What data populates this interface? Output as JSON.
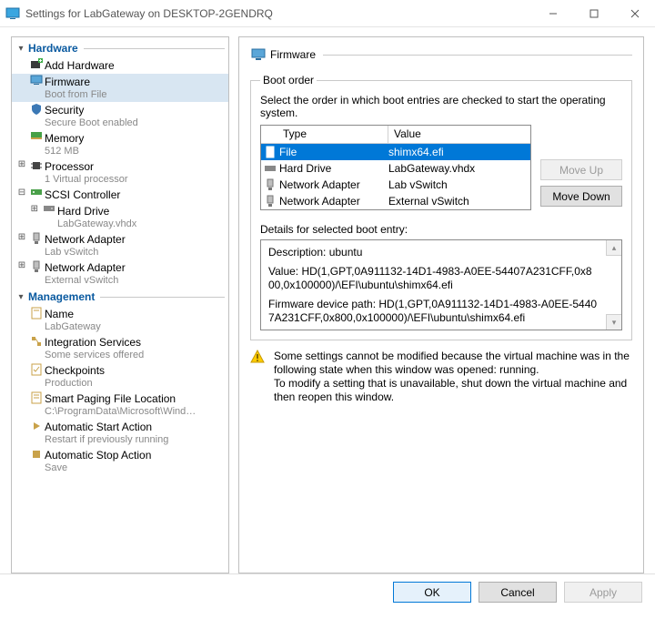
{
  "window": {
    "title": "Settings for LabGateway on DESKTOP-2GENDRQ"
  },
  "nav": {
    "hardware_label": "Hardware",
    "management_label": "Management",
    "add_hardware": "Add Hardware",
    "firmware": {
      "label": "Firmware",
      "sub": "Boot from File"
    },
    "security": {
      "label": "Security",
      "sub": "Secure Boot enabled"
    },
    "memory": {
      "label": "Memory",
      "sub": "512 MB"
    },
    "processor": {
      "label": "Processor",
      "sub": "1 Virtual processor"
    },
    "scsi": {
      "label": "SCSI Controller"
    },
    "hard_drive": {
      "label": "Hard Drive",
      "sub": "LabGateway.vhdx"
    },
    "na1": {
      "label": "Network Adapter",
      "sub": "Lab vSwitch"
    },
    "na2": {
      "label": "Network Adapter",
      "sub": "External vSwitch"
    },
    "name": {
      "label": "Name",
      "sub": "LabGateway"
    },
    "integration": {
      "label": "Integration Services",
      "sub": "Some services offered"
    },
    "checkpoints": {
      "label": "Checkpoints",
      "sub": "Production"
    },
    "paging": {
      "label": "Smart Paging File Location",
      "sub": "C:\\ProgramData\\Microsoft\\Windo..."
    },
    "autostart": {
      "label": "Automatic Start Action",
      "sub": "Restart if previously running"
    },
    "autostop": {
      "label": "Automatic Stop Action",
      "sub": "Save"
    }
  },
  "panel": {
    "title": "Firmware",
    "boot_legend": "Boot order",
    "instruction": "Select the order in which boot entries are checked to start the operating system.",
    "col_type": "Type",
    "col_value": "Value",
    "entries": [
      {
        "type": "File",
        "value": "shimx64.efi",
        "icon": "file"
      },
      {
        "type": "Hard Drive",
        "value": "LabGateway.vhdx",
        "icon": "hdd"
      },
      {
        "type": "Network Adapter",
        "value": "Lab vSwitch",
        "icon": "net"
      },
      {
        "type": "Network Adapter",
        "value": "External vSwitch",
        "icon": "net"
      }
    ],
    "move_up": "Move Up",
    "move_down": "Move Down",
    "details_label": "Details for selected boot entry:",
    "details_desc": "Description: ubuntu",
    "details_value": "Value: HD(1,GPT,0A911132-14D1-4983-A0EE-54407A231CFF,0x800,0x100000)/\\EFI\\ubuntu\\shimx64.efi",
    "details_path": "Firmware device path: HD(1,GPT,0A911132-14D1-4983-A0EE-54407A231CFF,0x800,0x100000)/\\EFI\\ubuntu\\shimx64.efi",
    "warn1": "Some settings cannot be modified because the virtual machine was in the following state when this window was opened: running.",
    "warn2": "To modify a setting that is unavailable, shut down the virtual machine and then reopen this window."
  },
  "footer": {
    "ok": "OK",
    "cancel": "Cancel",
    "apply": "Apply"
  }
}
